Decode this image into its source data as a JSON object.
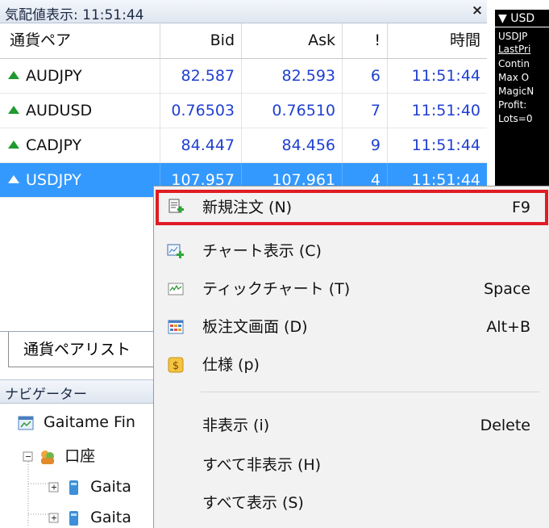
{
  "market_watch": {
    "title": "気配値表示: 11:51:44",
    "close_glyph": "×",
    "columns": {
      "symbol": "通貨ペア",
      "bid": "Bid",
      "ask": "Ask",
      "spread": "!",
      "time": "時間"
    },
    "rows": [
      {
        "symbol": "AUDJPY",
        "bid": "82.587",
        "ask": "82.593",
        "spread": "6",
        "time": "11:51:44"
      },
      {
        "symbol": "AUDUSD",
        "bid": "0.76503",
        "ask": "0.76510",
        "spread": "7",
        "time": "11:51:40"
      },
      {
        "symbol": "CADJPY",
        "bid": "84.447",
        "ask": "84.456",
        "spread": "9",
        "time": "11:51:44"
      },
      {
        "symbol": "USDJPY",
        "bid": "107.957",
        "ask": "107.961",
        "spread": "4",
        "time": "11:51:44"
      }
    ],
    "tab_label": "通貨ペアリスト"
  },
  "navigator": {
    "title": "ナビゲーター",
    "items": {
      "root": "Gaitame Fin",
      "accounts": "口座",
      "acc1": "Gaita",
      "acc2": "Gaita"
    }
  },
  "expert_panel": {
    "header": "USD",
    "lines": [
      "USDJP",
      "LastPri",
      "Contin",
      "Max O",
      "MagicN",
      "Profit:",
      "Lots=0"
    ]
  },
  "context_menu": {
    "items": [
      {
        "label": "新規注文 (N)",
        "shortcut": "F9",
        "icon": "new-order-icon"
      },
      {
        "label": "チャート表示 (C)",
        "shortcut": "",
        "icon": "chart-window-icon"
      },
      {
        "label": "ティックチャート (T)",
        "shortcut": "Space",
        "icon": "tick-chart-icon"
      },
      {
        "label": "板注文画面 (D)",
        "shortcut": "Alt+B",
        "icon": "depth-of-market-icon"
      },
      {
        "label": "仕様 (p)",
        "shortcut": "",
        "icon": "specification-icon"
      },
      {
        "label": "非表示 (i)",
        "shortcut": "Delete",
        "icon": ""
      },
      {
        "label": "すべて非表示 (H)",
        "shortcut": "",
        "icon": ""
      },
      {
        "label": "すべて表示 (S)",
        "shortcut": "",
        "icon": ""
      }
    ]
  },
  "colors": {
    "selection": "#3399ff",
    "highlight_border": "#e01c24",
    "up_arrow": "#1f9a2f",
    "price_text": "#1f3fd0"
  }
}
